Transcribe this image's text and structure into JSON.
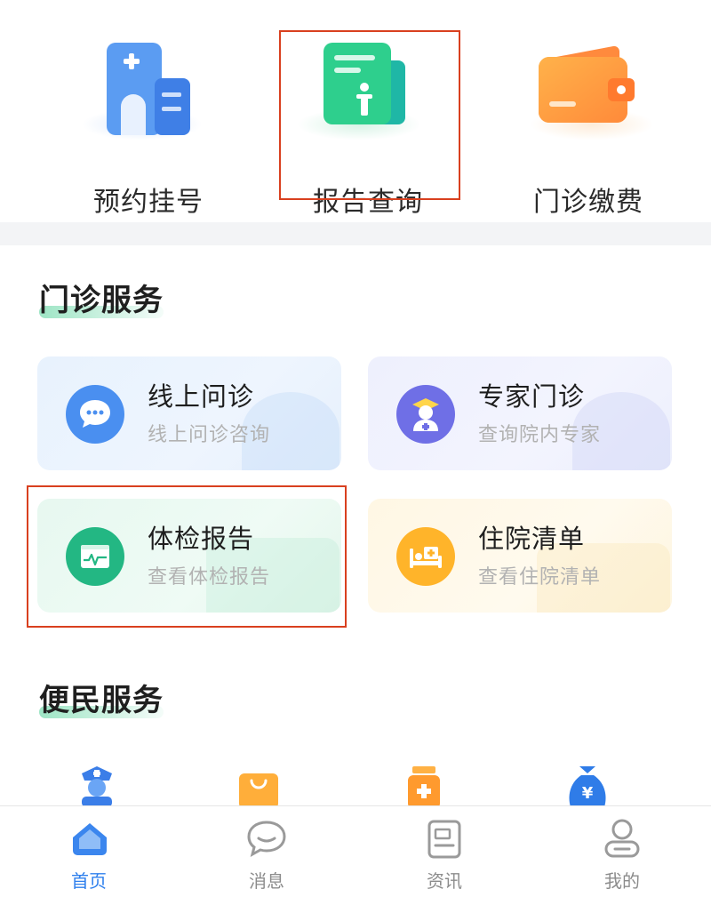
{
  "top_shortcuts": [
    {
      "label": "预约挂号",
      "icon": "hospital-icon"
    },
    {
      "label": "报告查询",
      "icon": "report-icon"
    },
    {
      "label": "门诊缴费",
      "icon": "wallet-icon"
    }
  ],
  "outpatient": {
    "title": "门诊服务",
    "cards": [
      {
        "title": "线上问诊",
        "subtitle": "线上问诊咨询",
        "icon": "chat-bubble-icon"
      },
      {
        "title": "专家门诊",
        "subtitle": "查询院内专家",
        "icon": "doctor-icon"
      },
      {
        "title": "体检报告",
        "subtitle": "查看体检报告",
        "icon": "monitor-icon"
      },
      {
        "title": "住院清单",
        "subtitle": "查看住院清单",
        "icon": "bed-icon"
      }
    ]
  },
  "convenience": {
    "title": "便民服务",
    "items": [
      {
        "icon": "nurse-icon"
      },
      {
        "icon": "shopping-bag-icon"
      },
      {
        "icon": "medicine-bottle-icon"
      },
      {
        "icon": "money-bag-icon"
      }
    ]
  },
  "nav": {
    "items": [
      {
        "label": "首页",
        "icon": "home-icon",
        "active": true
      },
      {
        "label": "消息",
        "icon": "message-icon",
        "active": false
      },
      {
        "label": "资讯",
        "icon": "news-icon",
        "active": false
      },
      {
        "label": "我的",
        "icon": "profile-icon",
        "active": false
      }
    ]
  },
  "colors": {
    "accent": "#2f80ed",
    "highlight_box": "#d9401f",
    "nav_inactive": "#8c8c8c"
  }
}
